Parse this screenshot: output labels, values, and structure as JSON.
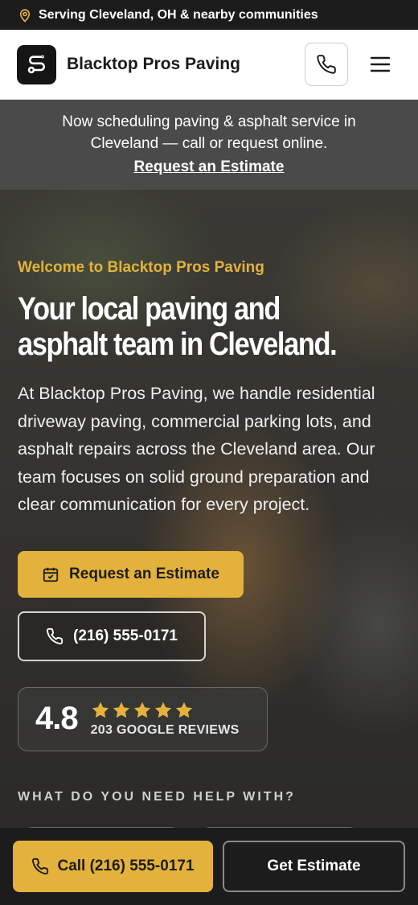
{
  "topbar": {
    "location_text": "Serving Cleveland, OH & nearby communities",
    "icon": "map-pin-icon"
  },
  "header": {
    "brand": "Blacktop Pros Paving",
    "logo_icon": "route-icon",
    "phone_icon": "phone-icon",
    "menu_icon": "hamburger-menu-icon"
  },
  "announcement": {
    "message": "Now scheduling paving & asphalt service in Cleveland — call or request online.",
    "link_label": "Request an Estimate"
  },
  "hero": {
    "eyebrow": "Welcome to Blacktop Pros Paving",
    "headline_line1": "Your local paving and",
    "headline_line2": "asphalt team in Cleveland.",
    "lead": "At Blacktop Pros Paving, we handle residential driveway paving, commercial parking lots, and asphalt repairs across the Cleveland area. Our team focuses on solid ground preparation and clear communication for every project.",
    "primary_button": "Request an Estimate",
    "phone_button": "(216) 555-0171"
  },
  "rating": {
    "score": "4.8",
    "stars": 5,
    "reviews_label": "203 GOOGLE REVIEWS"
  },
  "help": {
    "title": "WHAT DO YOU NEED HELP WITH?"
  },
  "bottombar": {
    "call_label": "Call (216) 555-0171",
    "estimate_label": "Get Estimate"
  },
  "colors": {
    "accent": "#e3b23c",
    "dark": "#1c1c1c",
    "announcement_bg": "#4a4a4a"
  }
}
